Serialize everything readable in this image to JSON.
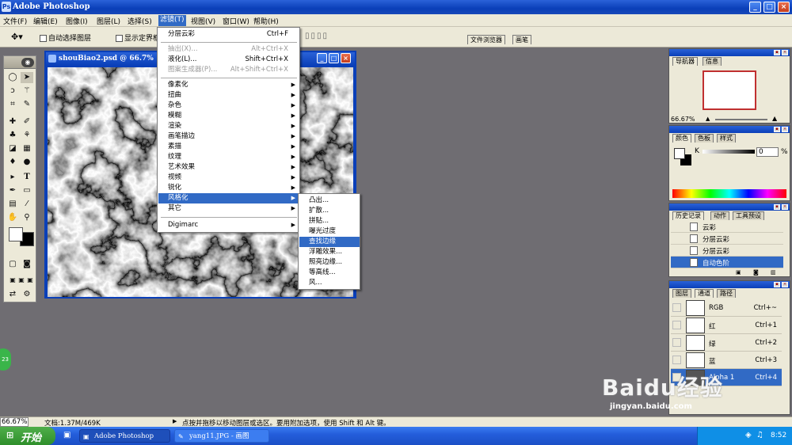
{
  "app": {
    "title": "Adobe Photoshop",
    "window_buttons": [
      "_",
      "□",
      "×"
    ]
  },
  "menubar": [
    "文件(F)",
    "编辑(E)",
    "图像(I)",
    "图层(L)",
    "选择(S)",
    "滤镜(T)",
    "视图(V)",
    "窗口(W)",
    "帮助(H)"
  ],
  "options": {
    "auto_select": "自动选择图层",
    "show_bounds": "显示定界框",
    "tab_file_browser": "文件浏览器",
    "tab_brush": "画笔"
  },
  "document": {
    "title": "shouBiao2.psd @ 66.7%"
  },
  "filter_menu": {
    "items": [
      {
        "label": "分层云彩",
        "shortcut": "Ctrl+F",
        "state": "normal"
      },
      {
        "label": "抽出(X)...",
        "shortcut": "Alt+Ctrl+X",
        "state": "disabled"
      },
      {
        "label": "液化(L)...",
        "shortcut": "Shift+Ctrl+X",
        "state": "normal"
      },
      {
        "label": "图案生成器(P)...",
        "shortcut": "Alt+Shift+Ctrl+X",
        "state": "disabled"
      },
      {
        "label": "像素化",
        "submenu": true
      },
      {
        "label": "扭曲",
        "submenu": true
      },
      {
        "label": "杂色",
        "submenu": true
      },
      {
        "label": "模糊",
        "submenu": true
      },
      {
        "label": "渲染",
        "submenu": true
      },
      {
        "label": "画笔描边",
        "submenu": true
      },
      {
        "label": "素描",
        "submenu": true
      },
      {
        "label": "纹理",
        "submenu": true
      },
      {
        "label": "艺术效果",
        "submenu": true
      },
      {
        "label": "视频",
        "submenu": true
      },
      {
        "label": "锐化",
        "submenu": true
      },
      {
        "label": "风格化",
        "submenu": true,
        "state": "highlighted"
      },
      {
        "label": "其它",
        "submenu": true
      },
      {
        "label": "Digimarc",
        "submenu": true
      }
    ]
  },
  "stylize_submenu": {
    "items": [
      "凸出...",
      "扩散...",
      "拼贴...",
      "曝光过度",
      "查找边缘",
      "浮雕效果...",
      "照亮边缘...",
      "等高线...",
      "风..."
    ],
    "highlighted": "查找边缘"
  },
  "navigator": {
    "tabs": [
      "导航器",
      "信息"
    ],
    "zoom": "66.67%"
  },
  "color_panel": {
    "tabs": [
      "颜色",
      "色板",
      "样式"
    ],
    "channel_label": "K",
    "value": "0",
    "unit": "%"
  },
  "history_panel": {
    "tabs": [
      "历史记录",
      "动作",
      "工具预设"
    ],
    "items": [
      "云彩",
      "分层云彩",
      "分层云彩",
      "自动色阶"
    ],
    "selected": "自动色阶"
  },
  "channels_panel": {
    "tabs": [
      "图层",
      "通道",
      "路径"
    ],
    "rows": [
      {
        "name": "RGB",
        "shortcut": "Ctrl+~"
      },
      {
        "name": "红",
        "shortcut": "Ctrl+1"
      },
      {
        "name": "绿",
        "shortcut": "Ctrl+2"
      },
      {
        "name": "蓝",
        "shortcut": "Ctrl+3"
      },
      {
        "name": "Alpha 1",
        "shortcut": "Ctrl+4"
      }
    ]
  },
  "statusbar": {
    "zoom": "66.67%",
    "doc": "文档:1.37M/469K",
    "hint": "点按并拖移以移动图层或选区。要用附加选项，使用 Shift 和 Alt 键。"
  },
  "taskbar": {
    "start": "开始",
    "tasks": [
      "Adobe Photoshop",
      "yang11.JPG - 画图"
    ],
    "time": "8:52",
    "badge": "23"
  },
  "watermark": {
    "brand": "Baidu经验",
    "url": "jingyan.baidu.com"
  }
}
